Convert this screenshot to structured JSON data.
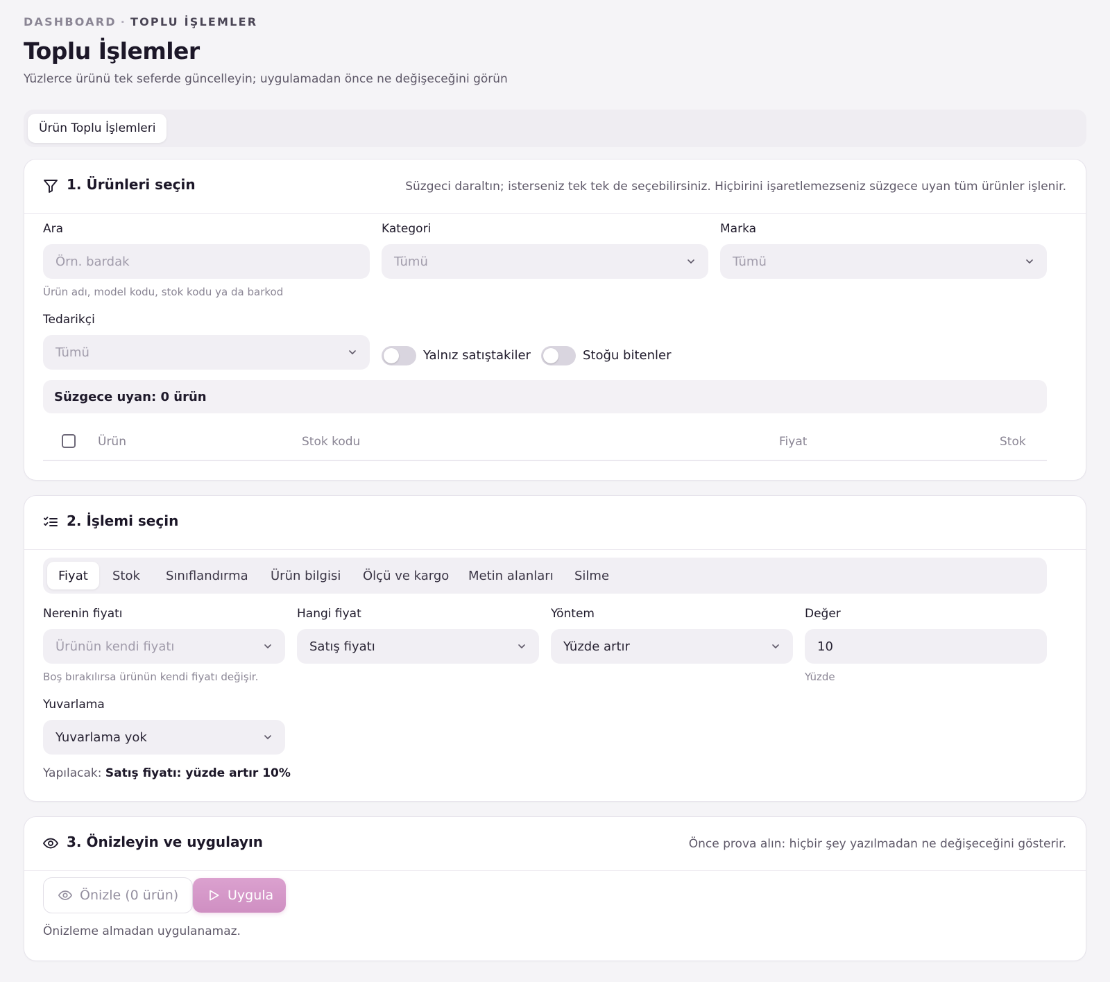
{
  "breadcrumb": {
    "root": "DASHBOARD",
    "separator": "·",
    "current": "TOPLU İŞLEMLER"
  },
  "header": {
    "title": "Toplu İşlemler",
    "subtitle": "Yüzlerce ürünü tek seferde güncelleyin; uygulamadan önce ne değişeceğini görün"
  },
  "tabs": {
    "active": "Ürün Toplu İşlemleri"
  },
  "step1": {
    "title": "1. Ürünleri seçin",
    "hint": "Süzgeci daraltın; isterseniz tek tek de seçebilirsiniz. Hiçbirini işaretlemezseniz süzgece uyan tüm ürünler işlenir.",
    "icon": "filter-icon",
    "search": {
      "label": "Ara",
      "placeholder": "Örn. bardak",
      "value": "",
      "help": "Ürün adı, model kodu, stok kodu ya da barkod"
    },
    "category": {
      "label": "Kategori",
      "value": "Tümü"
    },
    "brand": {
      "label": "Marka",
      "value": "Tümü"
    },
    "supplier": {
      "label": "Tedarikçi",
      "value": "Tümü"
    },
    "toggles": {
      "on_sale": {
        "label": "Yalnız satıştakiler",
        "checked": false
      },
      "out_of_stock": {
        "label": "Stoğu bitenler",
        "checked": false
      }
    },
    "match_count": "Süzgece uyan: 0 ürün",
    "table": {
      "columns": [
        "Ürün",
        "Stok kodu",
        "Fiyat",
        "Stok"
      ],
      "rows": []
    }
  },
  "step2": {
    "title": "2. İşlemi seçin",
    "icon": "list-check-icon",
    "tabs": [
      "Fiyat",
      "Stok",
      "Sınıflandırma",
      "Ürün bilgisi",
      "Ölçü ve kargo",
      "Metin alanları",
      "Silme"
    ],
    "active_tab": "Fiyat",
    "source_price": {
      "label": "Nerenin fiyatı",
      "value": "Ürünün kendi fiyatı",
      "help": "Boş bırakılırsa ürünün kendi fiyatı değişir."
    },
    "which_price": {
      "label": "Hangi fiyat",
      "value": "Satış fiyatı"
    },
    "method": {
      "label": "Yöntem",
      "value": "Yüzde artır"
    },
    "amount": {
      "label": "Değer",
      "value": "10",
      "help": "Yüzde"
    },
    "rounding": {
      "label": "Yuvarlama",
      "value": "Yuvarlama yok"
    },
    "summary": {
      "prefix": "Yapılacak:",
      "text": "Satış fiyatı: yüzde artır 10%"
    }
  },
  "step3": {
    "title": "3. Önizleyin ve uygulayın",
    "icon": "eye-icon",
    "hint": "Önce prova alın: hiçbir şey yazılmadan ne değişeceğini gösterir.",
    "preview_button": "Önizle (0 ürün)",
    "apply_button": "Uygula",
    "note": "Önizleme almadan uygulanamaz."
  },
  "colors": {
    "accent": "#d89ccb",
    "background": "#f5f4f7",
    "card": "#ffffff",
    "field": "#f1eff4"
  }
}
